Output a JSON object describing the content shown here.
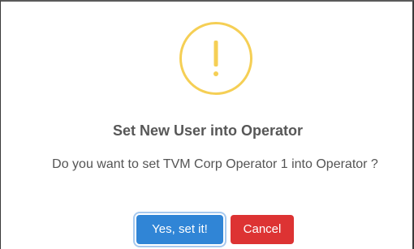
{
  "dialog": {
    "icon": "warning-icon",
    "icon_glyph": "!",
    "icon_color": "#f5cf55",
    "title": "Set New User into Operator",
    "message": "Do you want to set TVM Corp Operator 1 into Operator ?",
    "confirm_label": "Yes, set it!",
    "cancel_label": "Cancel",
    "confirm_color": "#3085d6",
    "cancel_color": "#dd3333"
  }
}
